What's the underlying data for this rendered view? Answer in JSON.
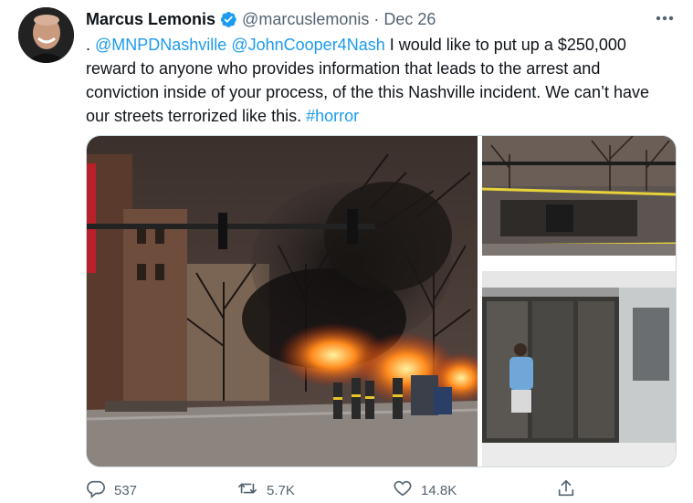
{
  "author": {
    "name": "Marcus Lemonis",
    "handle": "@marcuslemonis",
    "separator": "·",
    "date": "Dec 26",
    "verified": true
  },
  "tweet": {
    "prefix": ". ",
    "mention1": "@MNPDNashville",
    "space": " ",
    "mention2": "@JohnCooper4Nash",
    "body": " I  would like to put up a $250,000 reward to anyone who provides information that leads to the arrest and conviction inside of your process, of the this Nashville incident. We can’t have our streets terrorized like this. ",
    "hashtag": "#horror"
  },
  "actions": {
    "replies": "537",
    "retweets": "5.7K",
    "likes": "14.8K"
  },
  "colors": {
    "accent": "#1d9bf0",
    "secondary_text": "#536471",
    "primary_text": "#0f1419"
  },
  "icons": {
    "verified": "verified-badge-icon",
    "more": "more-icon",
    "reply": "reply-icon",
    "retweet": "retweet-icon",
    "like": "heart-icon",
    "share": "share-icon"
  }
}
